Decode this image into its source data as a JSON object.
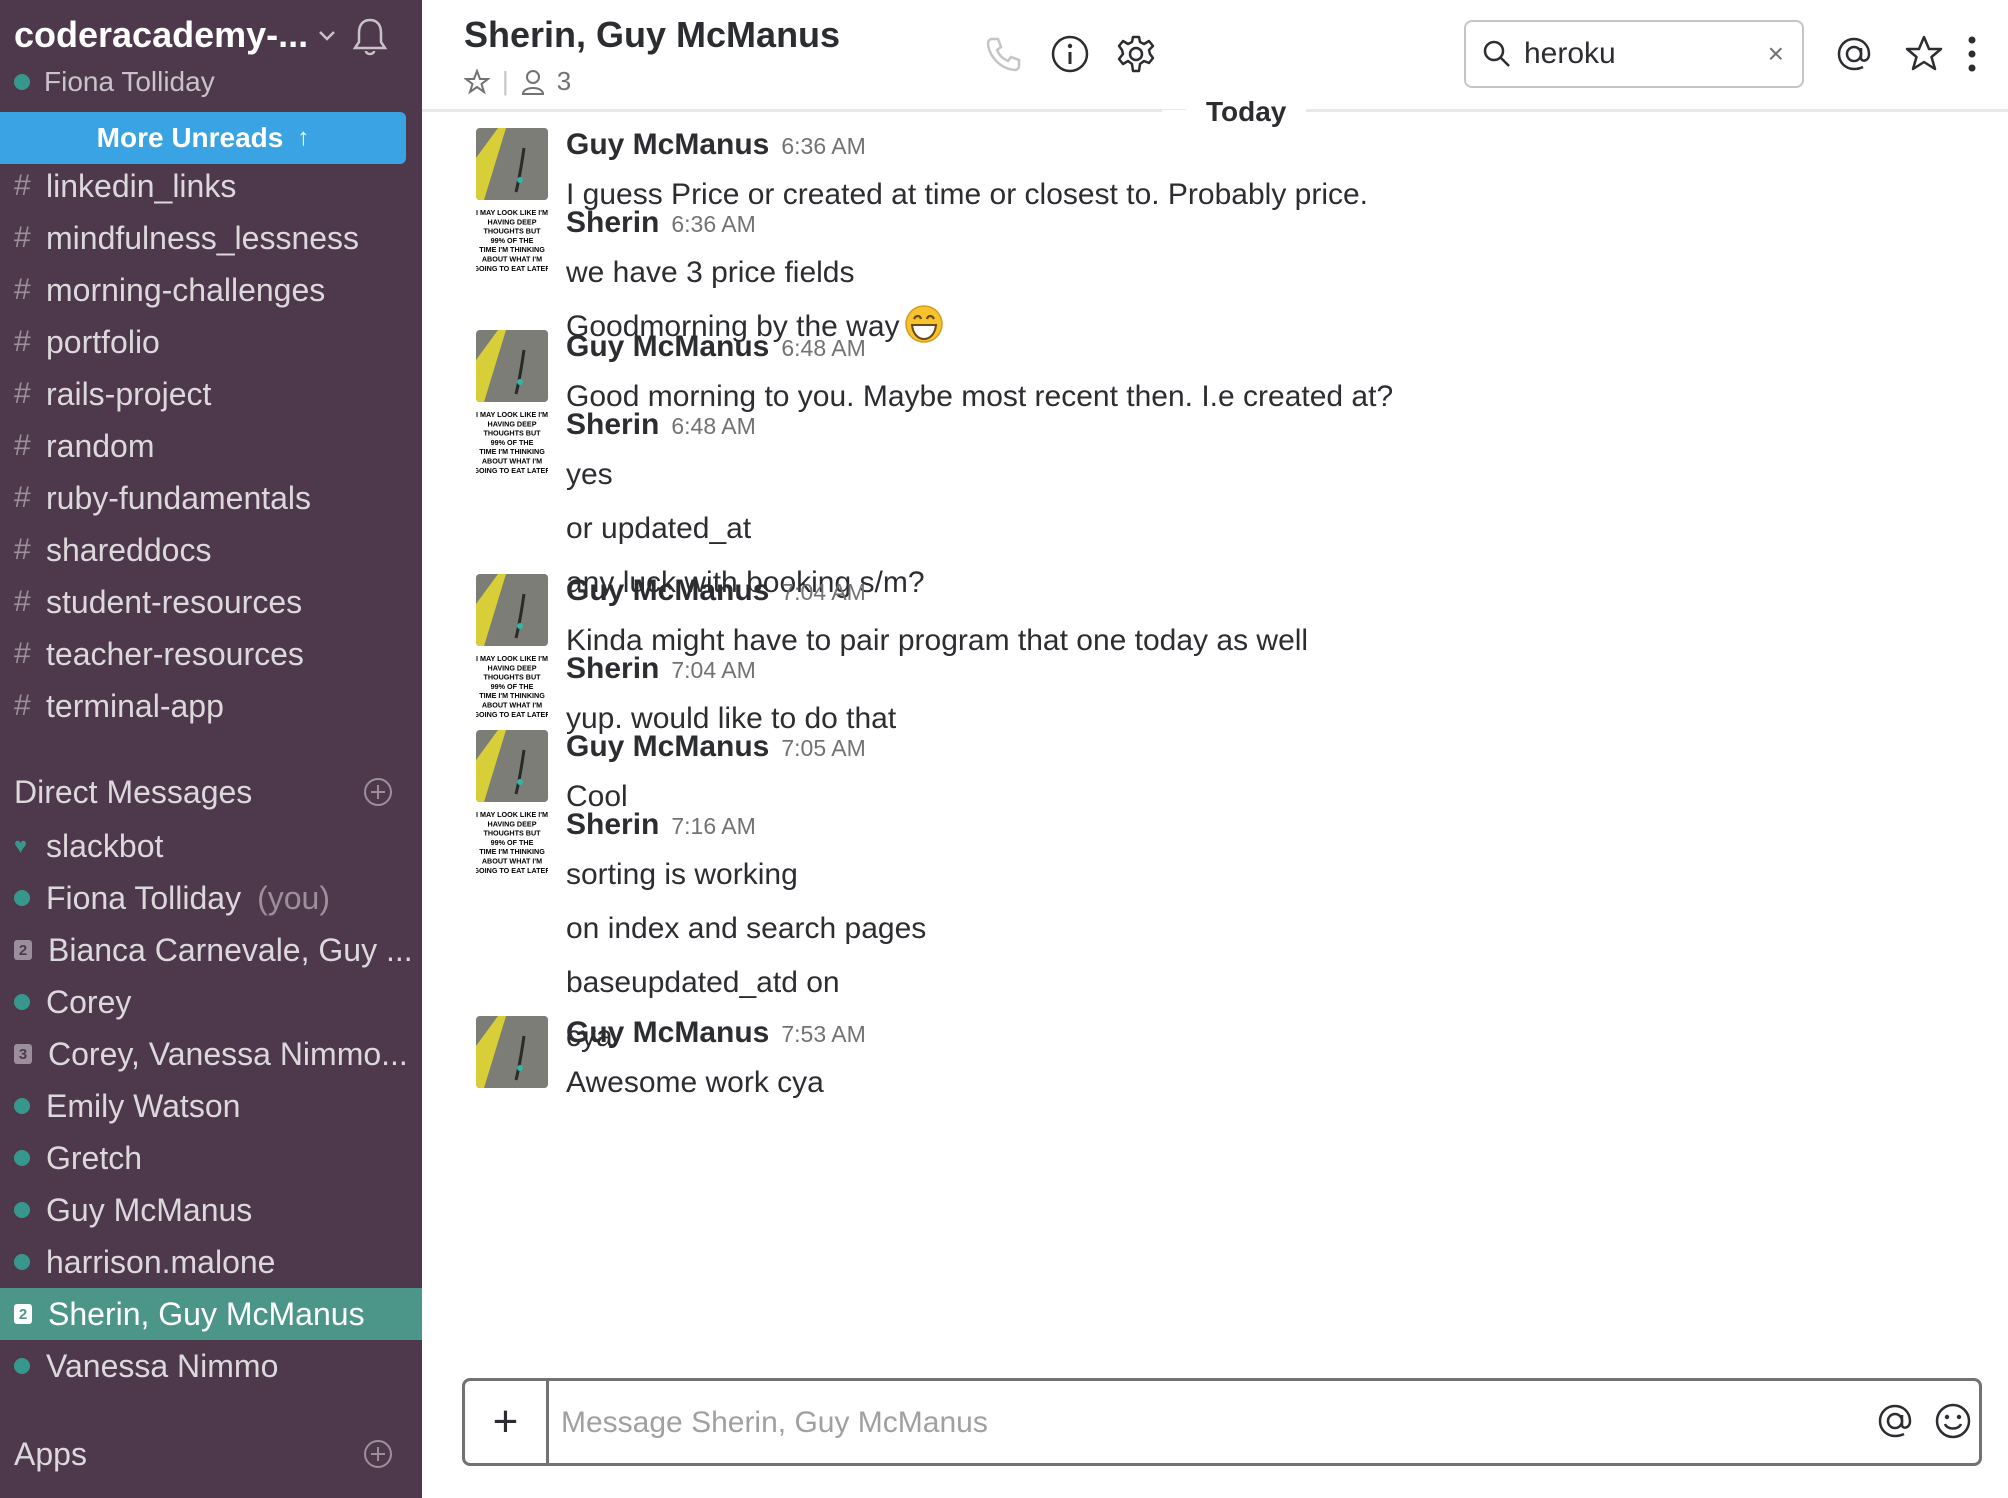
{
  "sidebar": {
    "team_name": "coderacademy-...",
    "user_name": "Fiona Tolliday",
    "more_unreads": "More Unreads",
    "channels": [
      {
        "name": "linkedin_links"
      },
      {
        "name": "mindfulness_lessness"
      },
      {
        "name": "morning-challenges"
      },
      {
        "name": "portfolio"
      },
      {
        "name": "rails-project"
      },
      {
        "name": "random"
      },
      {
        "name": "ruby-fundamentals"
      },
      {
        "name": "shareddocs"
      },
      {
        "name": "student-resources"
      },
      {
        "name": "teacher-resources"
      },
      {
        "name": "terminal-app"
      }
    ],
    "direct_messages_heading": "Direct Messages",
    "direct_messages": [
      {
        "name": "slackbot",
        "marker": "heart"
      },
      {
        "name": "Fiona Tolliday",
        "marker": "dot",
        "suffix": "(you)"
      },
      {
        "name": "Bianca Carnevale, Guy ...",
        "marker": "count",
        "count": "2"
      },
      {
        "name": "Corey",
        "marker": "dot"
      },
      {
        "name": "Corey, Vanessa Nimmo...",
        "marker": "count",
        "count": "3"
      },
      {
        "name": "Emily Watson",
        "marker": "dot"
      },
      {
        "name": "Gretch",
        "marker": "dot"
      },
      {
        "name": "Guy McManus",
        "marker": "dot"
      },
      {
        "name": "harrison.malone",
        "marker": "dot"
      },
      {
        "name": "Sherin, Guy McManus",
        "marker": "count",
        "count": "2",
        "active": true
      },
      {
        "name": "Vanessa Nimmo",
        "marker": "dot"
      }
    ],
    "apps_heading": "Apps"
  },
  "header": {
    "title": "Sherin, Guy McManus",
    "member_count": "3",
    "search_value": "heroku",
    "search_clear": "×"
  },
  "day_divider": "Today",
  "messages": [
    {
      "author": "Guy McManus",
      "avatar": "guy",
      "time": "6:36 AM",
      "lines": [
        "I guess Price or created at time or closest to.  Probably price."
      ]
    },
    {
      "author": "Sherin",
      "avatar": "sherin",
      "time": "6:36 AM",
      "lines": [
        "we have 3 price fields",
        "Goodmorning by the way"
      ],
      "emoji_on_line": 1
    },
    {
      "author": "Guy McManus",
      "avatar": "guy",
      "time": "6:48 AM",
      "lines": [
        "Good morning to you.  Maybe most recent then.  I.e created at?"
      ]
    },
    {
      "author": "Sherin",
      "avatar": "sherin",
      "time": "6:48 AM",
      "lines": [
        "yes",
        "or updated_at",
        "any luck with booking s/m?"
      ]
    },
    {
      "author": "Guy McManus",
      "avatar": "guy",
      "time": "7:04 AM",
      "lines": [
        "Kinda might have to pair program that one today as well"
      ]
    },
    {
      "author": "Sherin",
      "avatar": "sherin",
      "time": "7:04 AM",
      "lines": [
        "yup. would like to do that"
      ]
    },
    {
      "author": "Guy McManus",
      "avatar": "guy",
      "time": "7:05 AM",
      "lines": [
        "Cool"
      ]
    },
    {
      "author": "Sherin",
      "avatar": "sherin",
      "time": "7:16 AM",
      "lines": [
        "sorting is working",
        "on index and search pages",
        "baseupdated_atd on",
        "cya"
      ]
    },
    {
      "author": "Guy McManus",
      "avatar": "guy",
      "time": "7:53 AM",
      "lines": [
        "Awesome work cya"
      ]
    }
  ],
  "avatar_text": {
    "sherin": [
      "I MAY LOOK LIKE I'M",
      "HAVING DEEP",
      "THOUGHTS BUT",
      "99% OF THE",
      "TIME I'M THINKING",
      "ABOUT WHAT I'M",
      "GOING TO EAT LATER"
    ]
  },
  "composer": {
    "placeholder": "Message Sherin, Guy McManus",
    "plus_label": "+"
  },
  "colors": {
    "sidebar_bg": "#4d394b",
    "active_item": "#4c9689",
    "more_unreads": "#3aa3e3",
    "presence": "#38978d"
  }
}
